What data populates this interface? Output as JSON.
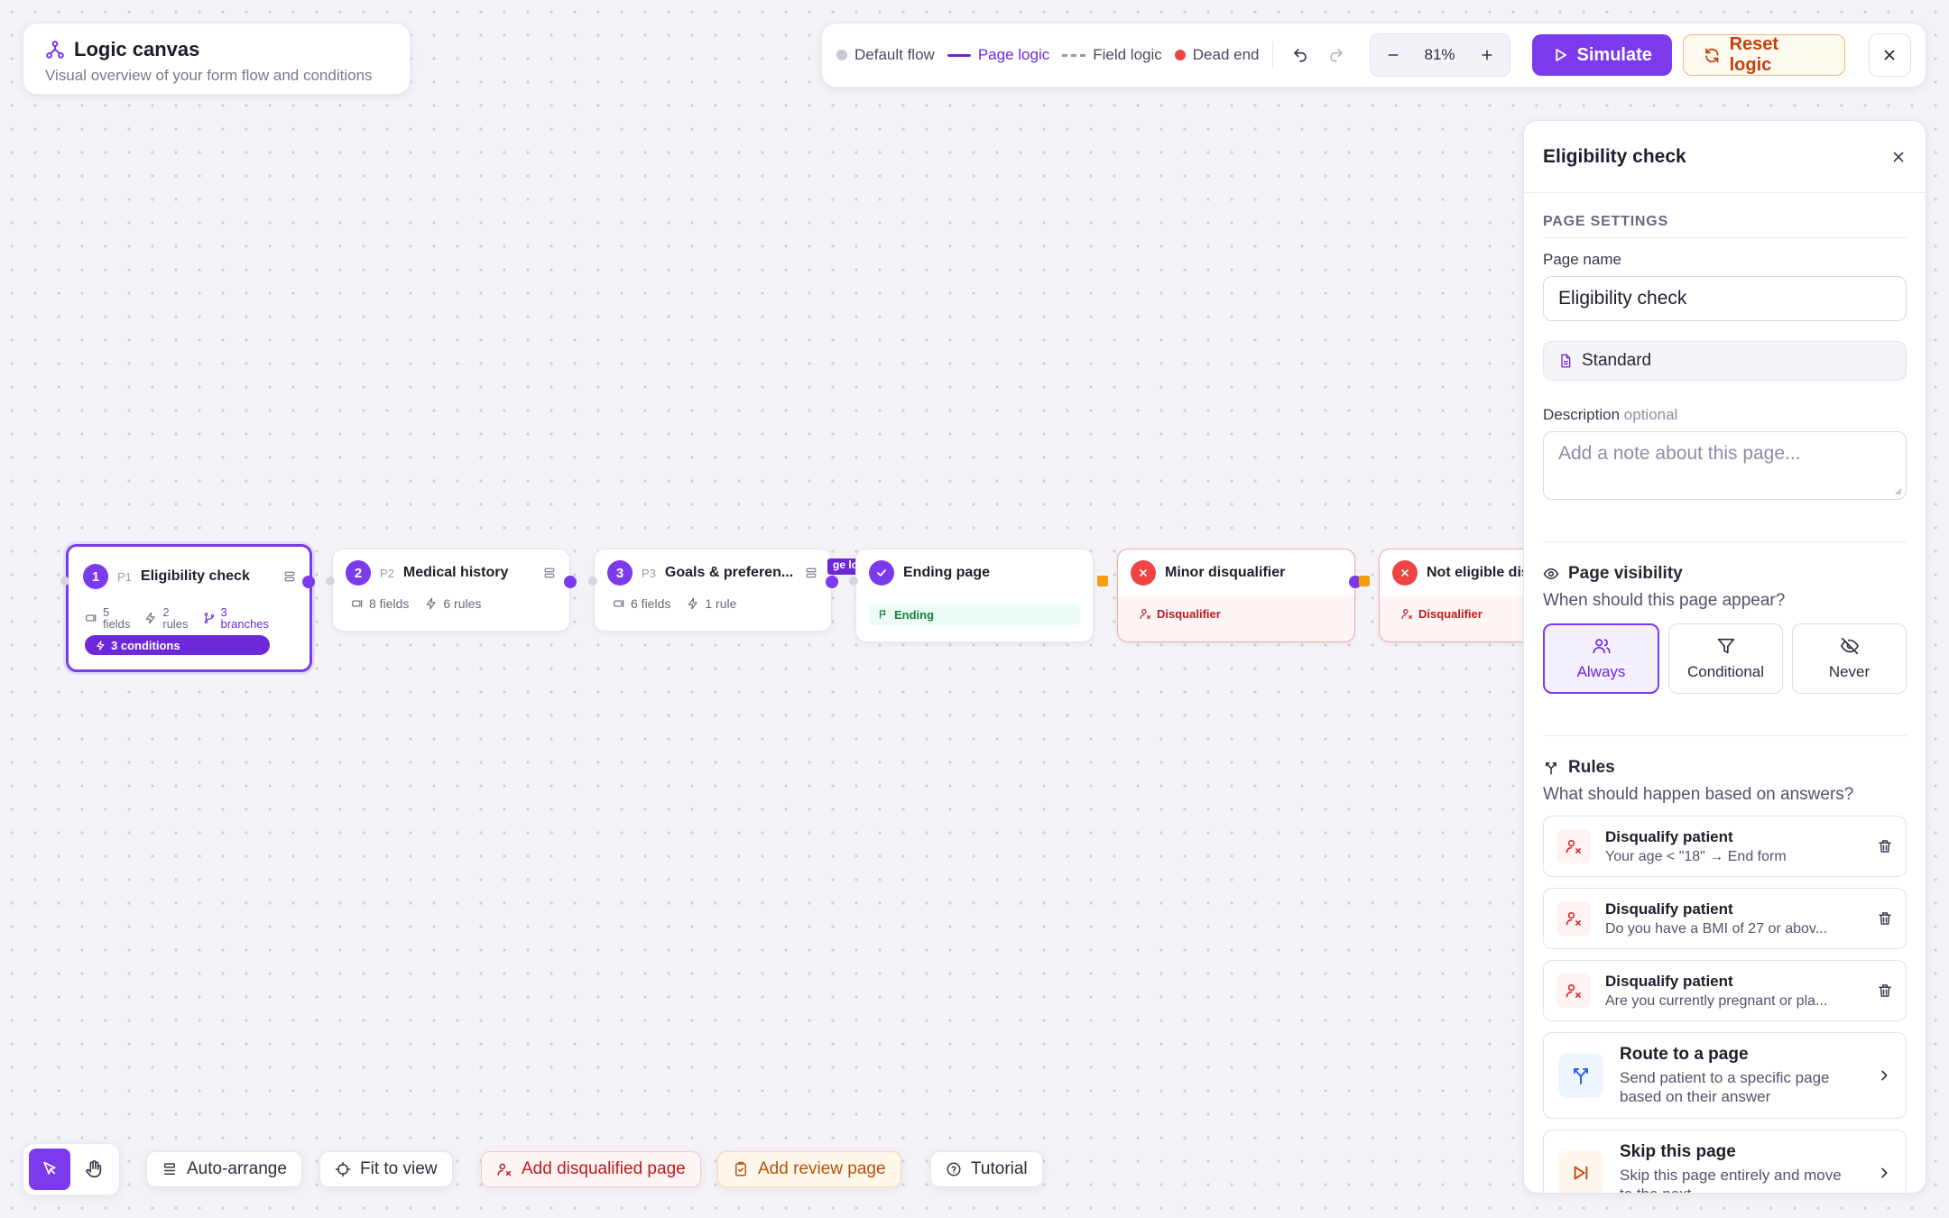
{
  "header": {
    "title": "Logic canvas",
    "subtitle": "Visual overview of your form flow and conditions"
  },
  "legend": {
    "default_flow": "Default flow",
    "page_logic": "Page logic",
    "field_logic": "Field logic",
    "dead_end": "Dead end"
  },
  "toolbar": {
    "zoom": "81%",
    "simulate": "Simulate",
    "reset": "Reset logic"
  },
  "colors": {
    "accent": "#7c3aed",
    "danger": "#ef4444",
    "warning": "#f59e0b",
    "success": "#16a34a"
  },
  "nodes": [
    {
      "num": "1",
      "pid": "P1",
      "name": "Eligibility check",
      "fields_num": "5",
      "fields_word": "fields",
      "rules_num": "2",
      "rules_word": "rules",
      "branches_num": "3",
      "branches_word": "branches",
      "conditions": "3 conditions"
    },
    {
      "num": "2",
      "pid": "P2",
      "name": "Medical history",
      "fields": "8 fields",
      "rules": "6 rules"
    },
    {
      "num": "3",
      "pid": "P3",
      "name": "Goals & preferen...",
      "fields": "6 fields",
      "rules": "1 rule"
    },
    {
      "name": "Ending page",
      "tag": "Ending"
    },
    {
      "name": "Minor disqualifier",
      "tag": "Disqualifier"
    },
    {
      "name": "Not eligible dis",
      "tag": "Disqualifier"
    }
  ],
  "edge_label": "ge lo",
  "panel": {
    "title": "Eligibility check",
    "section": "PAGE SETTINGS",
    "page_name_label": "Page name",
    "page_name_value": "Eligibility check",
    "page_type": "Standard",
    "description_label": "Description",
    "description_optional": "optional",
    "description_placeholder": "Add a note about this page...",
    "visibility_title": "Page visibility",
    "visibility_question": "When should this page appear?",
    "visibility_options": [
      "Always",
      "Conditional",
      "Never"
    ],
    "rules_title": "Rules",
    "rules_question": "What should happen based on answers?",
    "rules": [
      {
        "title": "Disqualify patient",
        "desc": "Your age < \"18\" → End form"
      },
      {
        "title": "Disqualify patient",
        "desc": "Do you have a BMI of 27 or abov..."
      },
      {
        "title": "Disqualify patient",
        "desc": "Are you currently pregnant or pla..."
      }
    ],
    "actions": [
      {
        "title": "Route to a page",
        "desc1": "Send patient to a specific page",
        "desc2": "based on their answer"
      },
      {
        "title": "Skip this page",
        "desc1": "Skip this page entirely and move",
        "desc2": "to the next"
      }
    ]
  },
  "bottom": {
    "auto_arrange": "Auto-arrange",
    "fit_to_view": "Fit to view",
    "add_disqualified": "Add disqualified page",
    "add_review": "Add review page",
    "tutorial": "Tutorial"
  }
}
